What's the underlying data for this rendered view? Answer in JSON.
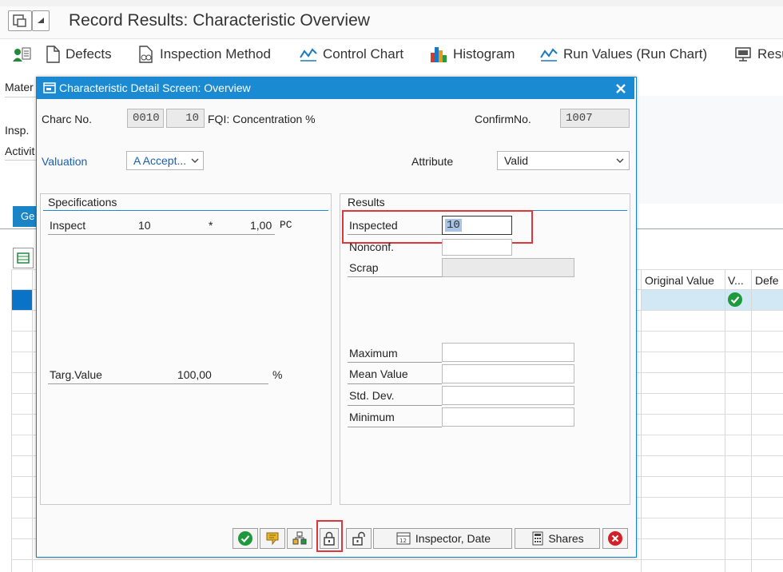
{
  "window": {
    "title": "Record Results: Characteristic Overview"
  },
  "toolbar": {
    "items": [
      {
        "label": "Defects",
        "icon": "page-icon"
      },
      {
        "label": "Inspection Method",
        "icon": "method-icon"
      },
      {
        "label": "Control Chart",
        "icon": "chart-line-icon"
      },
      {
        "label": "Histogram",
        "icon": "histogram-icon"
      },
      {
        "label": "Run Values (Run Chart)",
        "icon": "chart-line-icon"
      },
      {
        "label": "Resu",
        "icon": "monitor-icon"
      }
    ]
  },
  "background": {
    "labels": [
      "Mater",
      "Insp.",
      "Activit"
    ],
    "tab_label": "Ge",
    "columns": [
      "Original Value",
      "V...",
      "Defe"
    ]
  },
  "dialog": {
    "title": "Characteristic Detail Screen: Overview",
    "charc_no_label": "Charc No.",
    "charc_no_value": "0010",
    "charc_no_value2": "10",
    "charc_description": "FQI: Concentration %",
    "confirm_no_label": "ConfirmNo.",
    "confirm_no_value": "1007",
    "valuation_label": "Valuation",
    "valuation_value": "A Accept...",
    "attribute_label": "Attribute",
    "attribute_value": "Valid",
    "specifications": {
      "title": "Specifications",
      "inspect_label": "Inspect",
      "inspect_value": "10",
      "inspect_mult": "*",
      "inspect_unit_value": "1,00",
      "inspect_unit": "PC",
      "target_label": "Targ.Value",
      "target_value": "100,00",
      "target_unit": "%"
    },
    "results": {
      "title": "Results",
      "inspected_label": "Inspected",
      "inspected_value": "10",
      "nonconf_label": "Nonconf.",
      "nonconf_value": "",
      "scrap_label": "Scrap",
      "maximum_label": "Maximum",
      "mean_label": "Mean Value",
      "stddev_label": "Std. Dev.",
      "minimum_label": "Minimum"
    },
    "buttons": {
      "inspector_date": "Inspector, Date",
      "shares": "Shares"
    }
  },
  "colors": {
    "dialog_header": "#1a8bd3",
    "highlight": "#e0353b",
    "selection": "#d3e8f5",
    "accept_green": "#1e9a3c",
    "cancel_red": "#d51f26"
  }
}
